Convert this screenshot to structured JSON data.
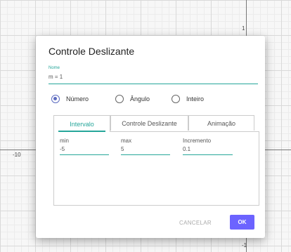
{
  "graph": {
    "axis_labels": {
      "y_top": "1",
      "x_left": "-10",
      "y_bottom": "-1"
    }
  },
  "dialog": {
    "title": "Controle Deslizante",
    "name_label": "Nome",
    "name_value": "m = 1",
    "radios": [
      {
        "label": "Número",
        "selected": true
      },
      {
        "label": "Ângulo",
        "selected": false
      },
      {
        "label": "Inteiro",
        "selected": false
      }
    ],
    "tabs": [
      {
        "label": "Intervalo",
        "active": true
      },
      {
        "label": "Controle Deslizante",
        "active": false
      },
      {
        "label": "Animação",
        "active": false
      }
    ],
    "fields": {
      "min": {
        "label": "min",
        "value": "-5"
      },
      "max": {
        "label": "max",
        "value": "5"
      },
      "increment": {
        "label": "Incremento",
        "value": "0.1"
      }
    },
    "buttons": {
      "cancel": "CANCELAR",
      "ok": "OK"
    }
  },
  "colors": {
    "accent_teal": "#26a69a",
    "radio_blue": "#5c6bc0",
    "ok_button": "#6c63ff"
  }
}
